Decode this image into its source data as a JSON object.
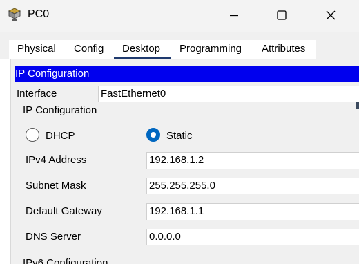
{
  "window": {
    "title": "PC0",
    "icon": "pc-app-icon"
  },
  "tabs": [
    {
      "label": "Physical",
      "active": false
    },
    {
      "label": "Config",
      "active": false
    },
    {
      "label": "Desktop",
      "active": true
    },
    {
      "label": "Programming",
      "active": false
    },
    {
      "label": "Attributes",
      "active": false
    }
  ],
  "ip_config": {
    "header": "IP Configuration",
    "interface_label": "Interface",
    "interface_value": "FastEthernet0",
    "group_title": "IP Configuration",
    "mode_options": [
      {
        "label": "DHCP",
        "selected": false
      },
      {
        "label": "Static",
        "selected": true
      }
    ],
    "fields": [
      {
        "label": "IPv4 Address",
        "value": "192.168.1.2"
      },
      {
        "label": "Subnet Mask",
        "value": "255.255.255.0"
      },
      {
        "label": "Default Gateway",
        "value": "192.168.1.1"
      },
      {
        "label": "DNS Server",
        "value": "0.0.0.0"
      }
    ],
    "ipv6_title": "IPv6 Configuration"
  },
  "colors": {
    "header_bg": "#0000ee",
    "radio_selected": "#0067c0",
    "active_tab_line": "#1f3a6e"
  }
}
